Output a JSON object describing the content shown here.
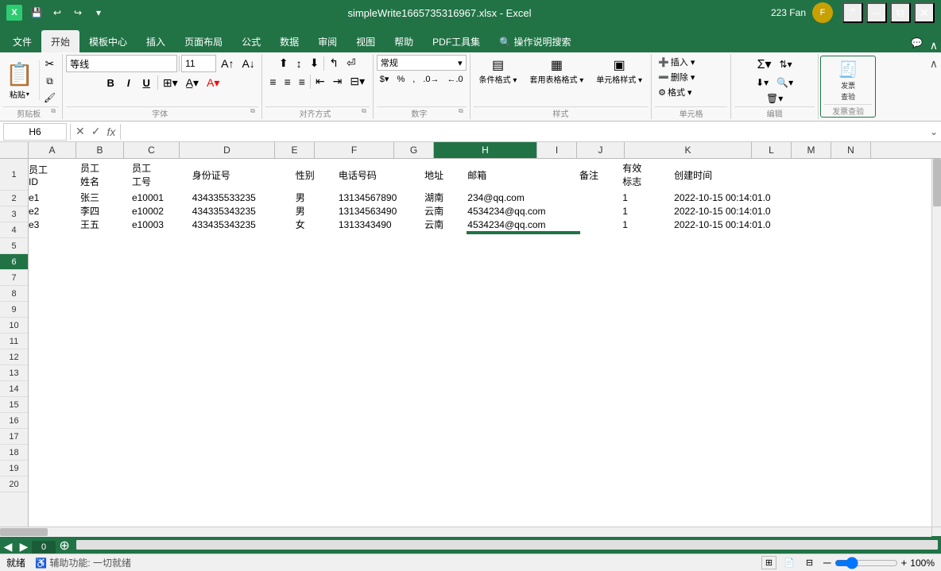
{
  "titleBar": {
    "title": "simpleWrite1665735316967.xlsx - Excel",
    "user": "223 Fan",
    "controls": [
      "minimize",
      "maximize",
      "close"
    ],
    "wb_controls": [
      "undo",
      "redo",
      "more"
    ]
  },
  "ribbon": {
    "tabs": [
      "文件",
      "开始",
      "模板中心",
      "插入",
      "页面布局",
      "公式",
      "数据",
      "审阅",
      "视图",
      "帮助",
      "PDF工具集",
      "操作说明搜索"
    ],
    "active_tab": "开始",
    "groups": {
      "clipboard": {
        "label": "剪贴板",
        "buttons": [
          "粘贴",
          "剪切",
          "复制",
          "格式刷"
        ]
      },
      "font": {
        "label": "字体",
        "font_name": "等线",
        "font_size": "11",
        "buttons": [
          "B",
          "I",
          "U",
          "边框",
          "填充",
          "字体颜色"
        ]
      },
      "alignment": {
        "label": "对齐方式",
        "buttons": [
          "左对齐",
          "居中",
          "右对齐",
          "增加缩进",
          "减少缩进",
          "合并居中",
          "自动换行"
        ]
      },
      "number": {
        "label": "数字",
        "format": "常规",
        "buttons": [
          "货币",
          "百分比",
          "千位",
          "增加小数",
          "减少小数"
        ]
      },
      "styles": {
        "label": "样式",
        "buttons": [
          "条件格式",
          "套用表格格式",
          "单元格样式"
        ]
      },
      "cells": {
        "label": "单元格",
        "buttons": [
          "插入",
          "删除",
          "格式"
        ]
      },
      "editing": {
        "label": "编辑",
        "buttons": [
          "求和",
          "填充",
          "清除",
          "排序筛选",
          "查找选择"
        ]
      },
      "invoice": {
        "label": "发票查验",
        "buttons": [
          "发票查验"
        ]
      }
    }
  },
  "formulaBar": {
    "cellRef": "H6",
    "formula": ""
  },
  "sheet": {
    "headers": [
      "A",
      "B",
      "C",
      "D",
      "E",
      "F",
      "G",
      "H",
      "I",
      "J",
      "K",
      "L",
      "M",
      "N"
    ],
    "columnHeaders": [
      {
        "col": "A",
        "label": "员工\nID"
      },
      {
        "col": "B",
        "label": "员工\n姓名"
      },
      {
        "col": "C",
        "label": "员工\n工号"
      },
      {
        "col": "D",
        "label": "身份证号"
      },
      {
        "col": "E",
        "label": "性别"
      },
      {
        "col": "F",
        "label": "电话号码"
      },
      {
        "col": "G",
        "label": "地址"
      },
      {
        "col": "H",
        "label": "邮箱"
      },
      {
        "col": "I",
        "label": "备注"
      },
      {
        "col": "J",
        "label": "有效\n标志"
      },
      {
        "col": "K",
        "label": "创建时间"
      },
      {
        "col": "L",
        "label": ""
      },
      {
        "col": "M",
        "label": ""
      },
      {
        "col": "N",
        "label": ""
      }
    ],
    "rows": [
      {
        "rowNum": 2,
        "type": "data",
        "cells": [
          "e1",
          "张三",
          "e10001",
          "434335533235",
          "男",
          "13134567890",
          "湖南",
          "234@qq.com",
          "",
          "1",
          "2022-10-15 00:14:01.0",
          "",
          "",
          ""
        ]
      },
      {
        "rowNum": 3,
        "type": "data",
        "cells": [
          "e2",
          "李四",
          "e10002",
          "434335343235",
          "男",
          "13134563490",
          "云南",
          "4534234@qq.com",
          "",
          "1",
          "2022-10-15 00:14:01.0",
          "",
          "",
          ""
        ]
      },
      {
        "rowNum": 4,
        "type": "data",
        "cells": [
          "e3",
          "王五",
          "e10003",
          "433435343235",
          "女",
          "1313343490",
          "云南",
          "4534234@qq.com",
          "",
          "1",
          "2022-10-15 00:14:01.0",
          "",
          "",
          ""
        ]
      }
    ],
    "emptyRows": [
      5,
      6,
      7,
      8,
      9,
      10,
      11,
      12,
      13,
      14,
      15,
      16,
      17,
      18,
      19,
      20
    ],
    "activeCell": "H6",
    "sheetTabs": [
      "0"
    ],
    "activeSheet": "0"
  },
  "statusBar": {
    "status": "就绪",
    "helper": "辅助功能: 一切就绪",
    "zoom": "100%"
  }
}
